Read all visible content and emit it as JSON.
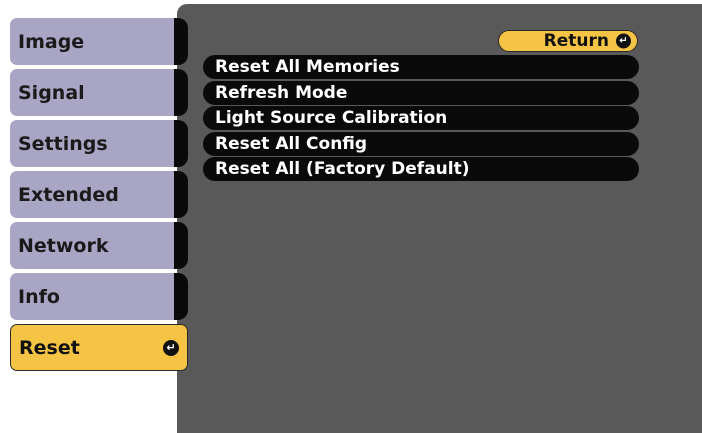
{
  "menu": {
    "tabs": [
      {
        "label": "Image"
      },
      {
        "label": "Signal"
      },
      {
        "label": "Settings"
      },
      {
        "label": "Extended"
      },
      {
        "label": "Network"
      },
      {
        "label": "Info"
      },
      {
        "label": "Reset",
        "selected": true
      }
    ]
  },
  "panel": {
    "return_label": "Return",
    "options": [
      {
        "label": "Reset All Memories"
      },
      {
        "label": "Refresh Mode"
      },
      {
        "label": "Light Source Calibration"
      },
      {
        "label": "Reset All Config"
      },
      {
        "label": "Reset All (Factory Default)"
      }
    ]
  },
  "colors": {
    "panel_background": "#595959",
    "inactive_tab": "#a8a6c4",
    "active_tab": "#f5c445",
    "option_background": "#0a0a0a"
  },
  "icons": {
    "enter": "enter-icon"
  }
}
